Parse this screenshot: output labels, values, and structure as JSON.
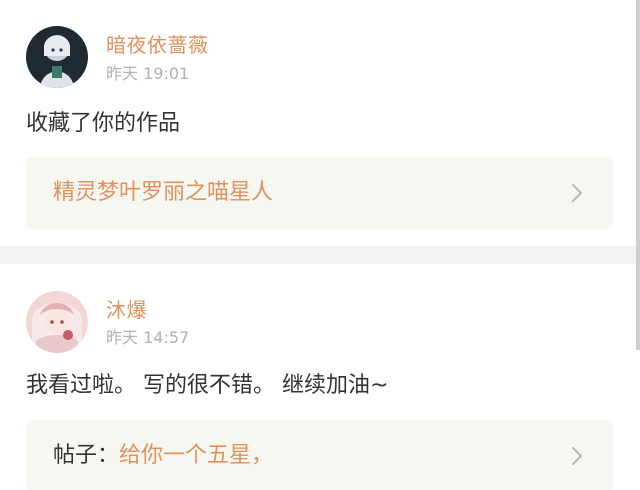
{
  "colors": {
    "accent": "#e0925d",
    "text": "#333333",
    "muted": "#b2b2b2",
    "box": "#f7f7f2",
    "separator": "#f2f2f2"
  },
  "items": [
    {
      "username": "暗夜依蔷薇",
      "time": "昨天 19:01",
      "message": "收藏了你的作品",
      "link": {
        "prefix": "",
        "title": "精灵梦叶罗丽之喵星人"
      },
      "icon": "chevron-right-icon"
    },
    {
      "username": "沐爆",
      "time": "昨天 14:57",
      "message": "我看过啦。 写的很不错。 继续加油~",
      "link": {
        "prefix": "帖子：",
        "title": "给你一个五星，"
      },
      "icon": "chevron-right-icon"
    }
  ]
}
